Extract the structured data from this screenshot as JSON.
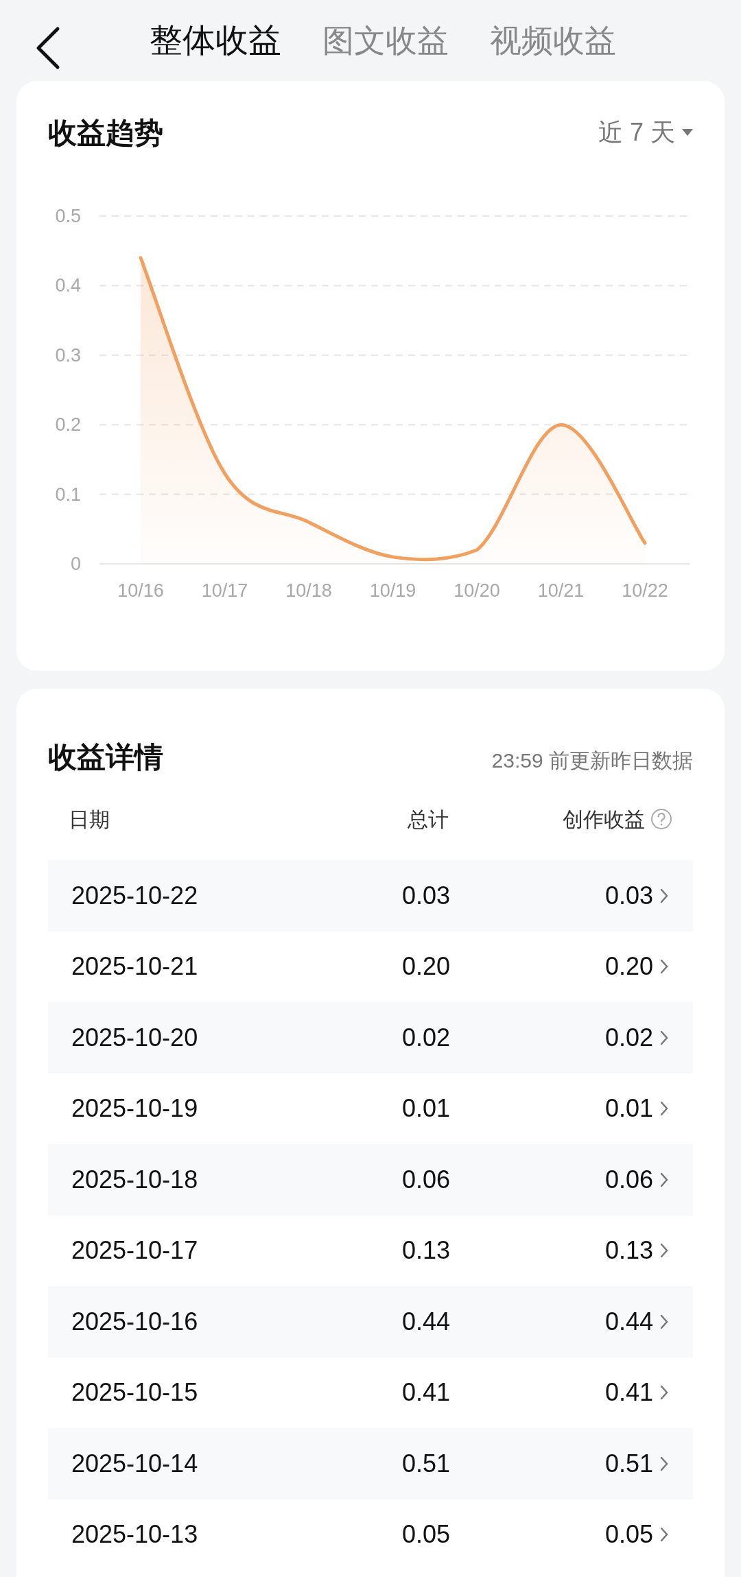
{
  "tabs": [
    {
      "label": "整体收益",
      "selected": true
    },
    {
      "label": "图文收益",
      "selected": false
    },
    {
      "label": "视频收益",
      "selected": false
    }
  ],
  "trend": {
    "title": "收益趋势",
    "range": "近 7 天",
    "chart_data": {
      "type": "area",
      "categories": [
        "10/16",
        "10/17",
        "10/18",
        "10/19",
        "10/20",
        "10/21",
        "10/22"
      ],
      "grid": true,
      "series": [
        {
          "color": "#f0a060",
          "values": [
            0.44,
            0.13,
            0.06,
            0.01,
            0.02,
            0.2,
            0.03
          ]
        }
      ],
      "ylim": [
        0,
        0.5
      ],
      "yticks": [
        {
          "value": 0.5,
          "label": "0.5"
        },
        {
          "value": 0.4,
          "label": "0.4"
        },
        {
          "value": 0.3,
          "label": "0.3"
        },
        {
          "value": 0.2,
          "label": "0.2"
        },
        {
          "value": 0.1,
          "label": "0.1"
        },
        {
          "value": 0,
          "label": "0"
        }
      ]
    }
  },
  "details": {
    "title": "收益详情",
    "note": "23:59 前更新昨日数据",
    "columns": [
      "日期",
      "总计",
      "创作收益"
    ],
    "rows": [
      {
        "date": "2025-10-22",
        "total": "0.03",
        "creation": "0.03"
      },
      {
        "date": "2025-10-21",
        "total": "0.20",
        "creation": "0.20"
      },
      {
        "date": "2025-10-20",
        "total": "0.02",
        "creation": "0.02"
      },
      {
        "date": "2025-10-19",
        "total": "0.01",
        "creation": "0.01"
      },
      {
        "date": "2025-10-18",
        "total": "0.06",
        "creation": "0.06"
      },
      {
        "date": "2025-10-17",
        "total": "0.13",
        "creation": "0.13"
      },
      {
        "date": "2025-10-16",
        "total": "0.44",
        "creation": "0.44"
      },
      {
        "date": "2025-10-15",
        "total": "0.41",
        "creation": "0.41"
      },
      {
        "date": "2025-10-14",
        "total": "0.51",
        "creation": "0.51"
      },
      {
        "date": "2025-10-13",
        "total": "0.05",
        "creation": "0.05"
      }
    ]
  }
}
